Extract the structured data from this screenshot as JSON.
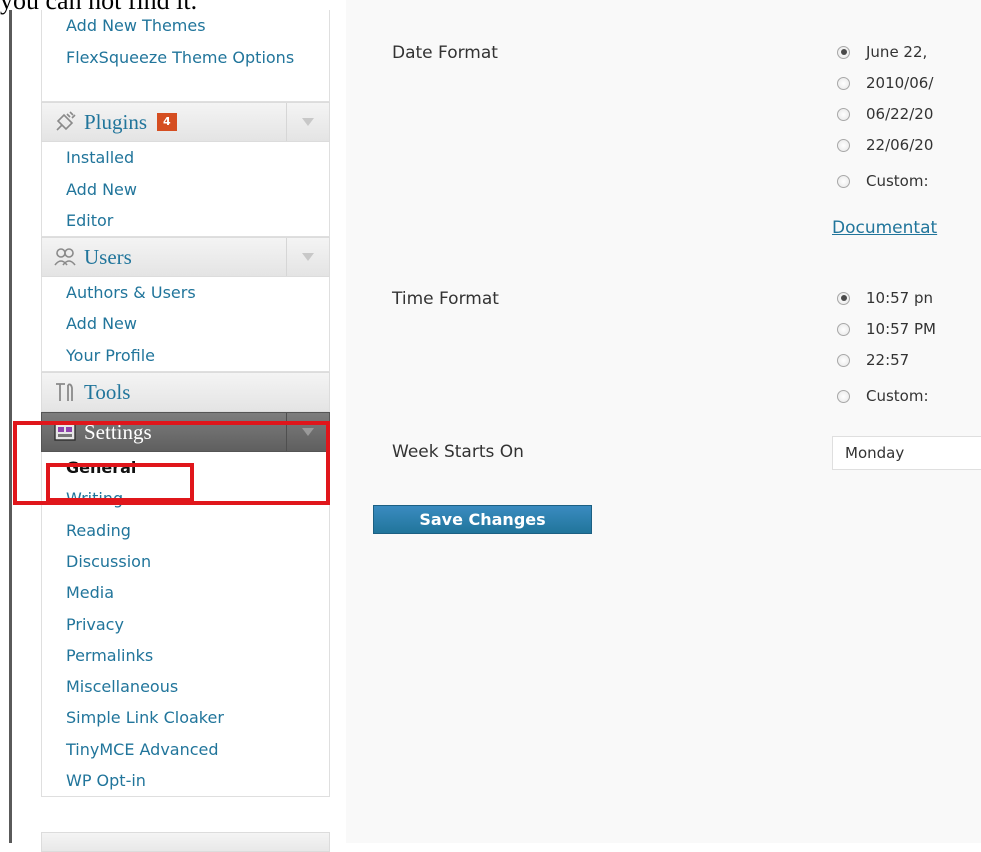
{
  "caption": "you can not find it.",
  "sidebar": {
    "appearance_items": [
      {
        "label": "Add New Themes"
      },
      {
        "label": "FlexSqueeze Theme Options"
      }
    ],
    "plugins": {
      "label": "Plugins",
      "badge": "4",
      "icon": "plug-icon",
      "items": [
        {
          "label": "Installed"
        },
        {
          "label": "Add New"
        },
        {
          "label": "Editor"
        }
      ]
    },
    "users": {
      "label": "Users",
      "icon": "users-icon",
      "items": [
        {
          "label": "Authors & Users"
        },
        {
          "label": "Add New"
        },
        {
          "label": "Your Profile"
        }
      ]
    },
    "tools": {
      "label": "Tools",
      "icon": "tools-icon"
    },
    "settings": {
      "label": "Settings",
      "icon": "settings-icon",
      "items": [
        {
          "label": "General",
          "current": true
        },
        {
          "label": "Writing"
        },
        {
          "label": "Reading"
        },
        {
          "label": "Discussion"
        },
        {
          "label": "Media"
        },
        {
          "label": "Privacy"
        },
        {
          "label": "Permalinks"
        },
        {
          "label": "Miscellaneous"
        },
        {
          "label": "Simple Link Cloaker"
        },
        {
          "label": "TinyMCE Advanced"
        },
        {
          "label": "WP Opt-in"
        }
      ]
    }
  },
  "main": {
    "date_format": {
      "label": "Date Format",
      "options": [
        {
          "text": "June 22,",
          "checked": true
        },
        {
          "text": "2010/06/",
          "checked": false
        },
        {
          "text": "06/22/20",
          "checked": false
        },
        {
          "text": "22/06/20",
          "checked": false
        },
        {
          "text": "Custom:",
          "checked": false
        }
      ],
      "doc_link": "Documentat"
    },
    "time_format": {
      "label": "Time Format",
      "options": [
        {
          "text": "10:57 pn",
          "checked": true
        },
        {
          "text": "10:57 PM",
          "checked": false
        },
        {
          "text": "22:57",
          "checked": false
        },
        {
          "text": "Custom:",
          "checked": false
        }
      ]
    },
    "week_starts_on": {
      "label": "Week Starts On",
      "value": "Monday"
    },
    "save_label": "Save Changes"
  },
  "colors": {
    "link": "#21759b",
    "highlight": "#e0161b",
    "badge": "#d54e21",
    "button": "#21759b"
  }
}
